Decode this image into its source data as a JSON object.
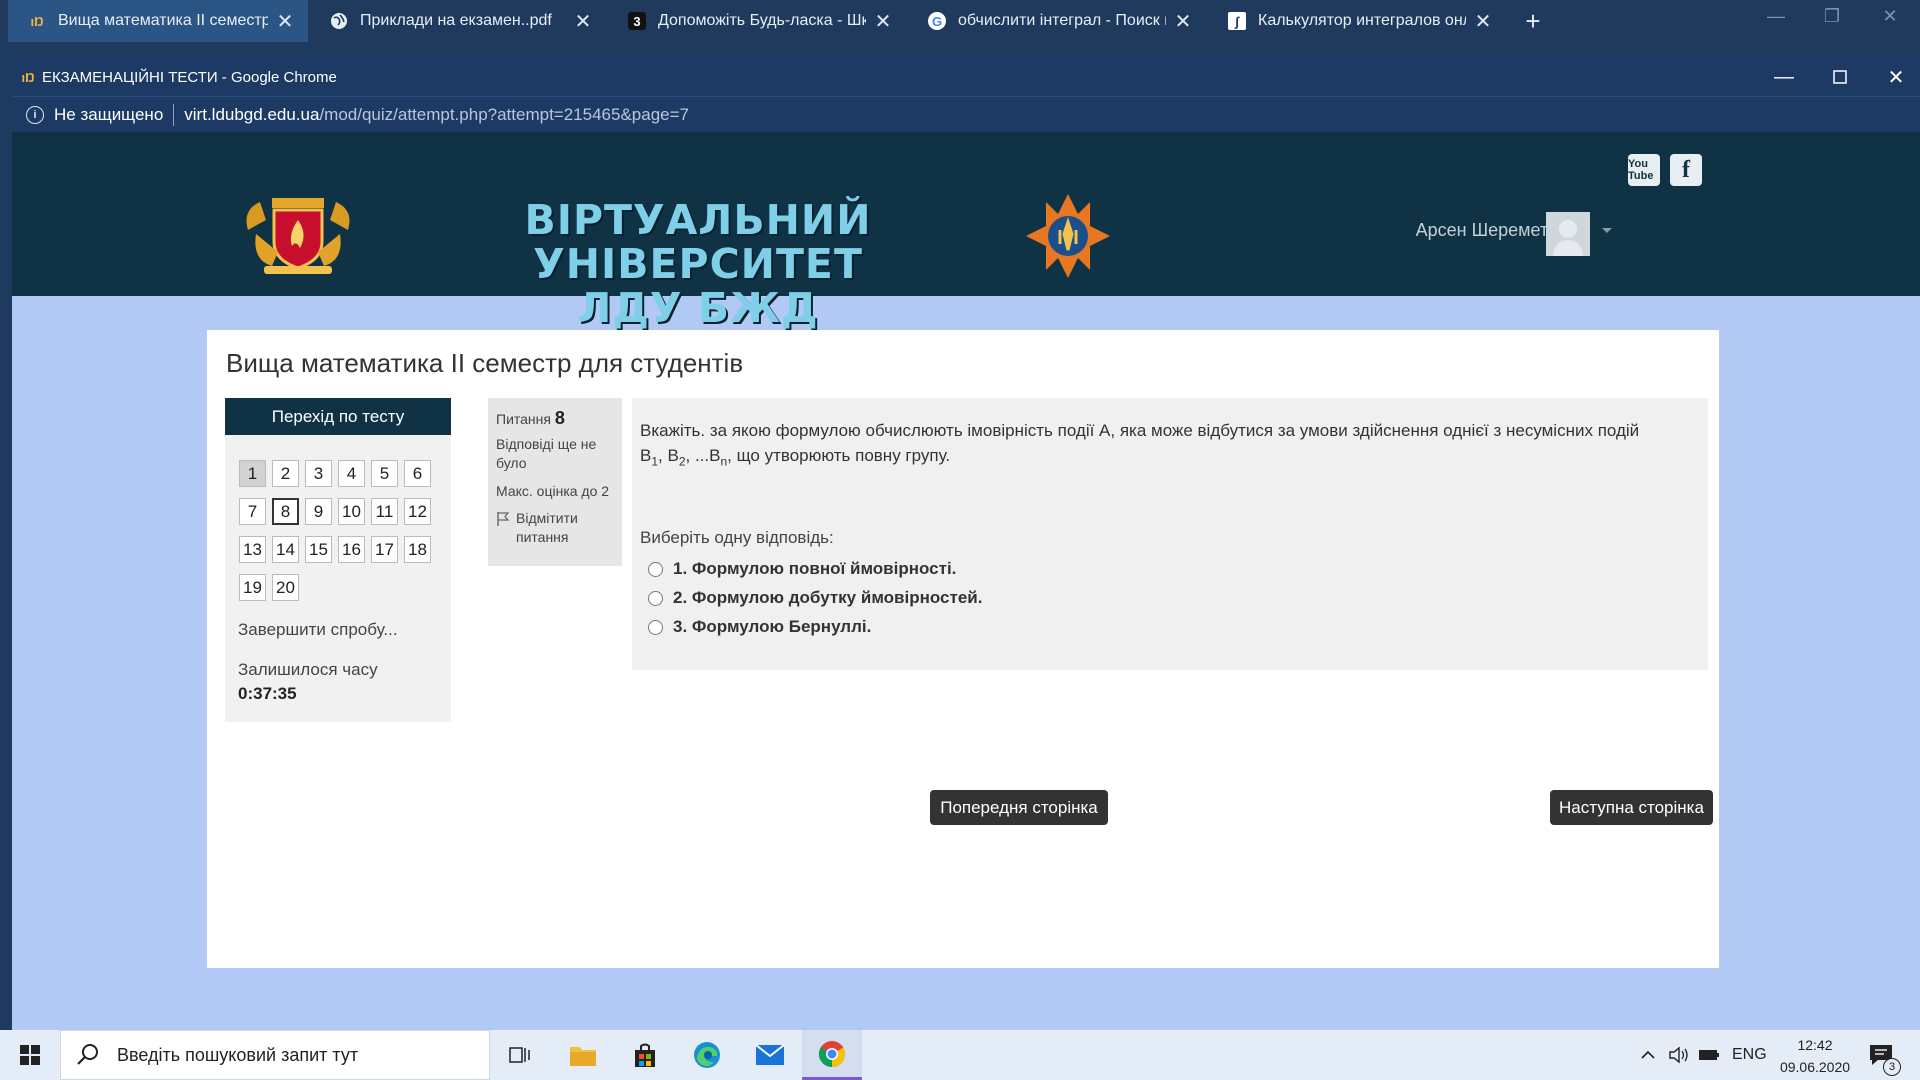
{
  "browser_tabs": [
    {
      "title": "Вища математика II семестр дл",
      "active": true
    },
    {
      "title": "Приклади на екзамен..pdf",
      "active": false
    },
    {
      "title": "Допоможіть Будь-ласка - Школ",
      "active": false
    },
    {
      "title": "обчислити інтеграл - Поиск в G",
      "active": false
    },
    {
      "title": "Калькулятор интегралов онлай",
      "active": false
    }
  ],
  "window": {
    "title": "ЕКЗАМЕНАЦІЙНІ ТЕСТИ - Google Chrome",
    "security_label": "Не защищено",
    "url_host": "virt.ldubgd.edu.ua",
    "url_path": "/mod/quiz/attempt.php?attempt=215465&page=7"
  },
  "site": {
    "title_line1": "ВІРТУАЛЬНИЙ УНІВЕРСИТЕТ",
    "title_line2": "ЛДУ БЖД",
    "youtube_label": "You Tube",
    "facebook_label": "f",
    "user_name": "Арсен Шеремета"
  },
  "course": {
    "title": "Вища математика II семестр для студентів"
  },
  "quiz_nav": {
    "heading": "Перехід по тесту",
    "questions": [
      "1",
      "2",
      "3",
      "4",
      "5",
      "6",
      "7",
      "8",
      "9",
      "10",
      "11",
      "12",
      "13",
      "14",
      "15",
      "16",
      "17",
      "18",
      "19",
      "20"
    ],
    "seen": [
      "1"
    ],
    "current": "8",
    "finish_label": "Завершити спробу...",
    "time_left_label": "Залишилося часу",
    "time_left_value": "0:37:35"
  },
  "question": {
    "label": "Питання",
    "number": "8",
    "state": "Відповіді ще не було",
    "max_grade": "Макс. оцінка до 2",
    "flag_label": "Відмітити питання",
    "text_main": "Вкажіть. за якою формулою обчислюють  імовірність події А, яка може відбутися за умови здійснення однієї з несумісних подій",
    "text_tail": ", що утворюють повну групу.",
    "events": [
      {
        "letter": "B",
        "sub": "1",
        "sep": ", "
      },
      {
        "letter": "B",
        "sub": "2",
        "sep": ", ...B"
      },
      {
        "letter": "",
        "sub": "n",
        "sep": ""
      }
    ],
    "prompt": "Виберіть одну відповідь:",
    "options": [
      "1. Формулою повної ймовірності.",
      "2. Формулою добутку ймовірностей.",
      "3. Формулою Бернуллі."
    ]
  },
  "buttons": {
    "previous": "Попередня сторінка",
    "next": "Наступна сторінка"
  },
  "taskbar": {
    "search_placeholder": "Введіть пошуковий запит тут",
    "language": "ENG",
    "time": "12:42",
    "date": "09.06.2020",
    "notification_count": "3"
  },
  "colors": {
    "header_bg": "#0f3345",
    "page_bg": "#b3c9f5",
    "button_bg": "#333333"
  }
}
